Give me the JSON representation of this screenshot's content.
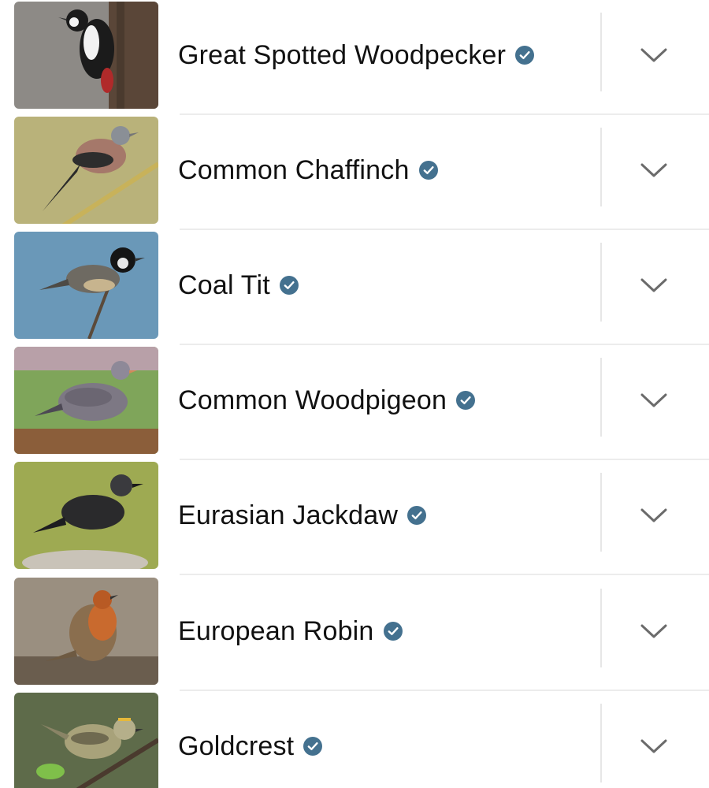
{
  "species_list": {
    "items": [
      {
        "name": "Great Spotted Woodpecker",
        "verified": true,
        "photo": {
          "bg": "#8d8a86",
          "accent": "#5a4638",
          "bird": "#1b1b1b"
        },
        "icon": "verified-check-icon",
        "expand_icon": "chevron-down-icon"
      },
      {
        "name": "Common Chaffinch",
        "verified": true,
        "photo": {
          "bg": "#b9b27a",
          "accent": "#c8b25a",
          "bird": "#a5786a"
        },
        "icon": "verified-check-icon",
        "expand_icon": "chevron-down-icon"
      },
      {
        "name": "Coal Tit",
        "verified": true,
        "photo": {
          "bg": "#6a98b8",
          "accent": "#5b4a3a",
          "bird": "#6e6a62"
        },
        "icon": "verified-check-icon",
        "expand_icon": "chevron-down-icon"
      },
      {
        "name": "Common Woodpigeon",
        "verified": true,
        "photo": {
          "bg": "#7fa55a",
          "accent": "#8b5e3a",
          "bird": "#7d7884"
        },
        "icon": "verified-check-icon",
        "expand_icon": "chevron-down-icon"
      },
      {
        "name": "Eurasian Jackdaw",
        "verified": true,
        "photo": {
          "bg": "#9eaa52",
          "accent": "#c9c3b8",
          "bird": "#2a2a2c"
        },
        "icon": "verified-check-icon",
        "expand_icon": "chevron-down-icon"
      },
      {
        "name": "European Robin",
        "verified": true,
        "photo": {
          "bg": "#9a8f80",
          "accent": "#6a5d4e",
          "bird": "#c96a2e"
        },
        "icon": "verified-check-icon",
        "expand_icon": "chevron-down-icon"
      },
      {
        "name": "Goldcrest",
        "verified": true,
        "photo": {
          "bg": "#5e6b4a",
          "accent": "#4a3a2e",
          "bird": "#a8a27a"
        },
        "icon": "verified-check-icon",
        "expand_icon": "chevron-down-icon"
      }
    ]
  },
  "colors": {
    "verified_badge": "#44718f",
    "chevron": "#6b6b6b",
    "text": "#111111",
    "divider": "#e6e6e6"
  }
}
